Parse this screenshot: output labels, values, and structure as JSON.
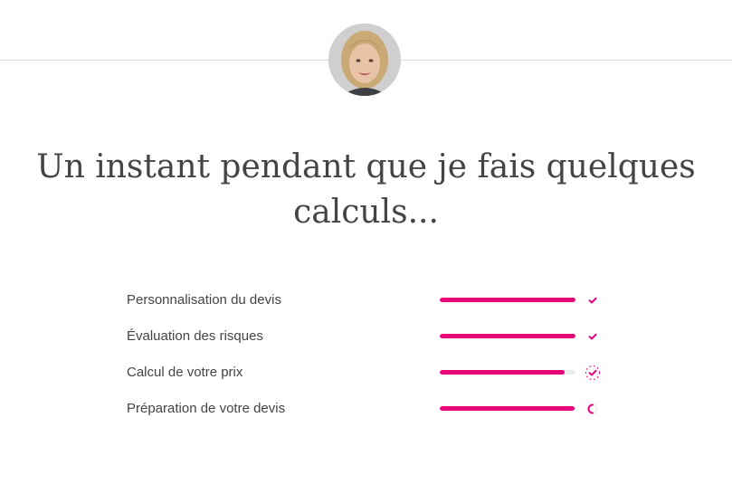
{
  "header": {
    "avatar_alt": "advisor-photo"
  },
  "main": {
    "title": "Un instant pendant que je fais quelques calculs..."
  },
  "steps": [
    {
      "label": "Personnalisation du devis",
      "progress": 1.0,
      "status": "check-icon"
    },
    {
      "label": "Évaluation des risques",
      "progress": 1.0,
      "status": "check-icon"
    },
    {
      "label": "Calcul de votre prix",
      "progress": 0.92,
      "status": "check-loading-icon"
    },
    {
      "label": "Préparation de votre devis",
      "progress": 0.99,
      "status": "spinner-icon"
    }
  ],
  "colors": {
    "accent": "#e8007d",
    "track": "#ececec",
    "text": "#444444",
    "divider": "#dcdcdc"
  }
}
